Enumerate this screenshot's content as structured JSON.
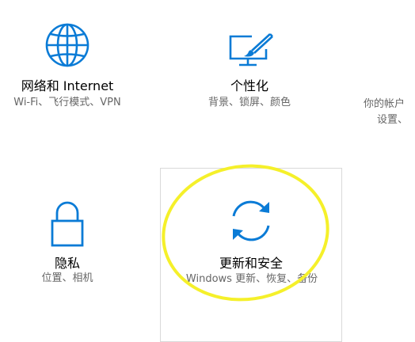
{
  "accent_color": "#0a7bd6",
  "highlight_color": "#f5f02a",
  "tiles": {
    "network": {
      "icon": "globe-icon",
      "title": "网络和 Internet",
      "desc": "Wi-Fi、飞行模式、VPN"
    },
    "personalization": {
      "icon": "paintbrush-screen-icon",
      "title": "个性化",
      "desc": "背景、锁屏、颜色"
    },
    "accounts": {
      "desc_line1": "你的帐户",
      "desc_line2": "设置、"
    },
    "privacy": {
      "icon": "lock-icon",
      "title": "隐私",
      "desc": "位置、相机"
    },
    "update_security": {
      "icon": "sync-icon",
      "title": "更新和安全",
      "desc": "Windows 更新、恢复、备份"
    }
  }
}
